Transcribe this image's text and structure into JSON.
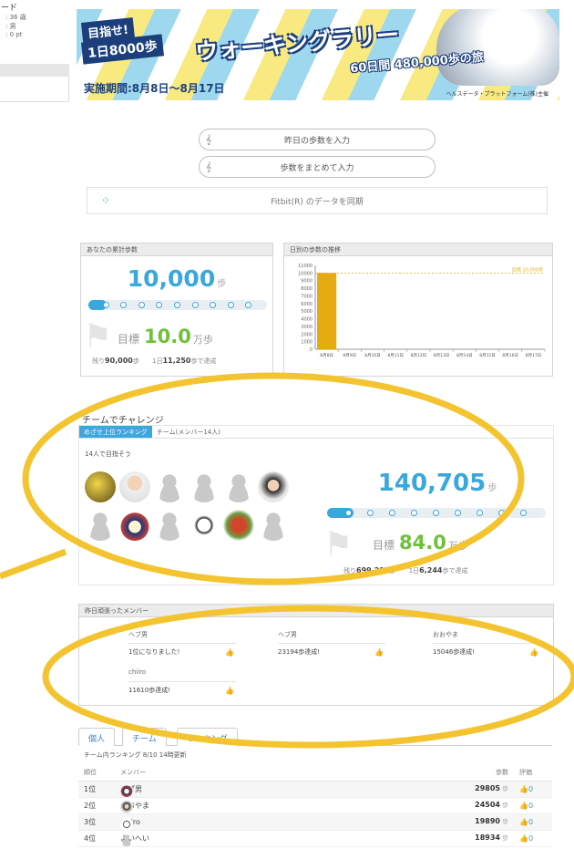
{
  "left_strip": {
    "title": "ード",
    "rows": [
      ": 36 歳",
      ": 男",
      ": 0 pt"
    ]
  },
  "banner": {
    "tag1": "目指せ!",
    "tag2": "1日8000歩",
    "title": "ウォーキングラリー",
    "subtitle": "60日間 480,000歩の旅",
    "period": "実施期間:8月8日〜8月17日",
    "org": "ヘルスデータ・プラットフォーム(株)主催"
  },
  "actions": {
    "enter_yesterday": "昨日の歩数を入力",
    "enter_bulk": "歩数をまとめて入力",
    "fitbit": "Fitbit(R) のデータを同期"
  },
  "personal": {
    "title": "あなたの累計歩数",
    "steps": "10,000",
    "steps_unit": "歩",
    "progress": 0.1,
    "goal_label": "目標",
    "goal_value": "10.0",
    "goal_unit": "万歩",
    "remain_label": "残り",
    "remain_value": "90,000",
    "remain_unit": "歩",
    "daily_label": "1日",
    "daily_value": "11,250",
    "daily_unit": "歩で達成"
  },
  "chart_data": {
    "type": "bar",
    "title": "日別の歩数の推移",
    "categories": [
      "8月8日",
      "8月9日",
      "8月10日",
      "8月11日",
      "8月12日",
      "8月13日",
      "8月14日",
      "8月15日",
      "8月16日",
      "8月17日"
    ],
    "values": [
      10000,
      0,
      0,
      0,
      0,
      0,
      0,
      0,
      0,
      0
    ],
    "ylim": [
      0,
      11000
    ],
    "yticks": [
      "11000",
      "10000",
      "9000",
      "8000",
      "7000",
      "6000",
      "5000",
      "4000",
      "3000",
      "2000",
      "1000",
      "0"
    ],
    "reference_line": {
      "value": 10000,
      "label": "目標 10,000歩"
    },
    "colors": {
      "bar": "#e6ab13",
      "ref": "#e6ab13"
    }
  },
  "team": {
    "heading": "チームでチャレンジ",
    "tabs": [
      "めざせ上位ランキング",
      "チーム(メンバー14人)"
    ],
    "subtitle": "14人で目指そう",
    "steps": "140,705",
    "steps_unit": "歩",
    "progress": 0.12,
    "goal_label": "目標",
    "goal_value": "84.0",
    "goal_unit": "万歩",
    "remain_label": "残り",
    "remain_value": "699,295",
    "remain_unit": "歩",
    "daily_label": "1日",
    "daily_value": "6,244",
    "daily_unit": "歩で達成"
  },
  "messages": {
    "title": "昨日頑張ったメンバー",
    "items": [
      {
        "name": "ヘブ男",
        "text": "1位になりました!"
      },
      {
        "name": "ヘブ男",
        "text": "23194歩達成!"
      },
      {
        "name": "おおやま",
        "text": "15046歩達成!"
      },
      {
        "name": "chiiro",
        "text": "11610歩達成!"
      }
    ]
  },
  "tabs": [
    "個人",
    "チーム",
    "ランキング"
  ],
  "table": {
    "caption": "チーム内ランキング 8/10 14時更新",
    "headers": [
      "順位",
      "メンバー",
      "歩数",
      "評価"
    ],
    "rows": [
      {
        "rank": "1位",
        "name": "ヘブ男",
        "steps": "29805",
        "likes": "0"
      },
      {
        "rank": "2位",
        "name": "おおやま",
        "steps": "24504",
        "likes": "0"
      },
      {
        "rank": "3位",
        "name": "chiiro",
        "steps": "19890",
        "likes": "0"
      },
      {
        "rank": "4位",
        "name": "よいへい",
        "steps": "18934",
        "likes": "0"
      }
    ],
    "step_unit": "歩"
  },
  "colors": {
    "accent": "#3aa7dd",
    "goal": "#6fc13b",
    "highlight": "#f4c430",
    "navy": "#1c3f7c"
  }
}
